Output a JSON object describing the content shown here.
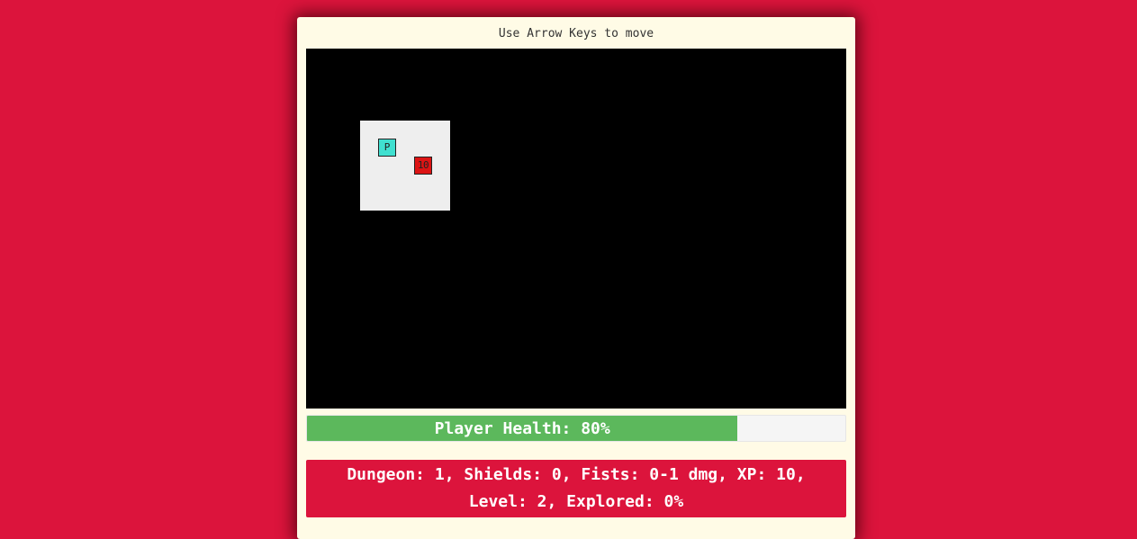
{
  "instructions": "Use Arrow Keys to move",
  "board": {
    "player_label": "P",
    "enemy_label": "10"
  },
  "health": {
    "label": "Player Health: 80%",
    "fraction": 0.8
  },
  "stats": {
    "line1": "Dungeon: 1, Shields: 0, Fists: 0-1 dmg, XP: 10,",
    "line2": "Level: 2, Explored: 0%"
  },
  "colors": {
    "background": "#dc143c",
    "panel": "#fffbe6",
    "board": "#000000",
    "room_floor": "#eeeeee",
    "player": "#40e0d0",
    "enemy": "#dc1414",
    "health_fill": "#5cb85c",
    "stats_background": "#dc143c"
  }
}
